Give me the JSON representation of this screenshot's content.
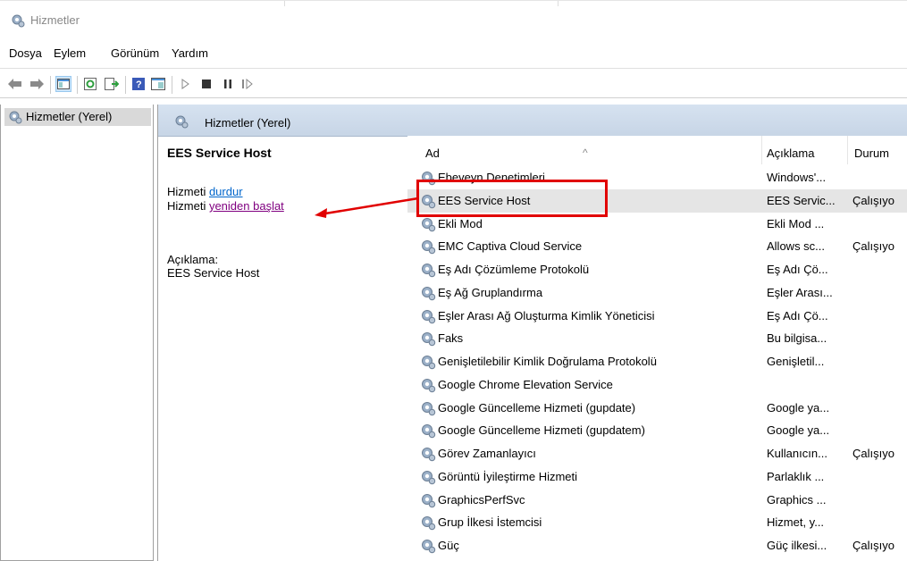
{
  "window": {
    "title": "Hizmetler",
    "title_icon": "gear-icon"
  },
  "menu": [
    "Dosya",
    "Eylem",
    "Görünüm",
    "Yardım"
  ],
  "toolbar": {
    "buttons": [
      "back-arrow-icon",
      "forward-arrow-icon",
      "console-tree-icon",
      "refresh-icon",
      "export-icon",
      "help-icon",
      "properties-icon",
      "play-icon",
      "stop-icon",
      "pause-icon",
      "resume-icon"
    ]
  },
  "tree": {
    "item": "Hizmetler (Yerel)"
  },
  "main": {
    "header": "Hizmetler (Yerel)",
    "selected_title": "EES Service Host",
    "action1_prefix": "Hizmeti ",
    "action1_link": "durdur",
    "action2_prefix": "Hizmeti ",
    "action2_link": "yeniden başlat",
    "desc_label": "Açıklama:",
    "desc_value": "EES Service Host"
  },
  "list": {
    "columns": [
      "Ad",
      "Açıklama",
      "Durum"
    ],
    "rows": [
      {
        "name": "Ebeveyn Denetimleri",
        "desc": "Windows'...",
        "status": ""
      },
      {
        "name": "EES Service Host",
        "desc": "EES Servic...",
        "status": "Çalışıyo",
        "selected": true
      },
      {
        "name": "Ekli Mod",
        "desc": "Ekli Mod ...",
        "status": ""
      },
      {
        "name": "EMC Captiva Cloud Service",
        "desc": "Allows sc...",
        "status": "Çalışıyo"
      },
      {
        "name": "Eş Adı Çözümleme Protokolü",
        "desc": "Eş Adı Çö...",
        "status": ""
      },
      {
        "name": "Eş Ağ Gruplandırma",
        "desc": "Eşler Arası...",
        "status": ""
      },
      {
        "name": "Eşler Arası Ağ Oluşturma Kimlik Yöneticisi",
        "desc": "Eş Adı Çö...",
        "status": ""
      },
      {
        "name": "Faks",
        "desc": "Bu bilgisa...",
        "status": ""
      },
      {
        "name": "Genişletilebilir Kimlik Doğrulama Protokolü",
        "desc": "Genişletil...",
        "status": ""
      },
      {
        "name": "Google Chrome Elevation Service",
        "desc": "",
        "status": ""
      },
      {
        "name": "Google Güncelleme Hizmeti (gupdate)",
        "desc": "Google ya...",
        "status": ""
      },
      {
        "name": "Google Güncelleme Hizmeti (gupdatem)",
        "desc": "Google ya...",
        "status": ""
      },
      {
        "name": "Görev Zamanlayıcı",
        "desc": "Kullanıcın...",
        "status": "Çalışıyo"
      },
      {
        "name": "Görüntü İyileştirme Hizmeti",
        "desc": "Parlaklık ...",
        "status": ""
      },
      {
        "name": "GraphicsPerfSvc",
        "desc": "Graphics ...",
        "status": ""
      },
      {
        "name": "Grup İlkesi İstemcisi",
        "desc": "Hizmet, y...",
        "status": ""
      },
      {
        "name": "Güç",
        "desc": "Güç ilkesi...",
        "status": "Çalışıyo"
      }
    ]
  },
  "colors": {
    "annotation": "#e10000",
    "link": "#0066cc",
    "visited_link": "#800080"
  }
}
